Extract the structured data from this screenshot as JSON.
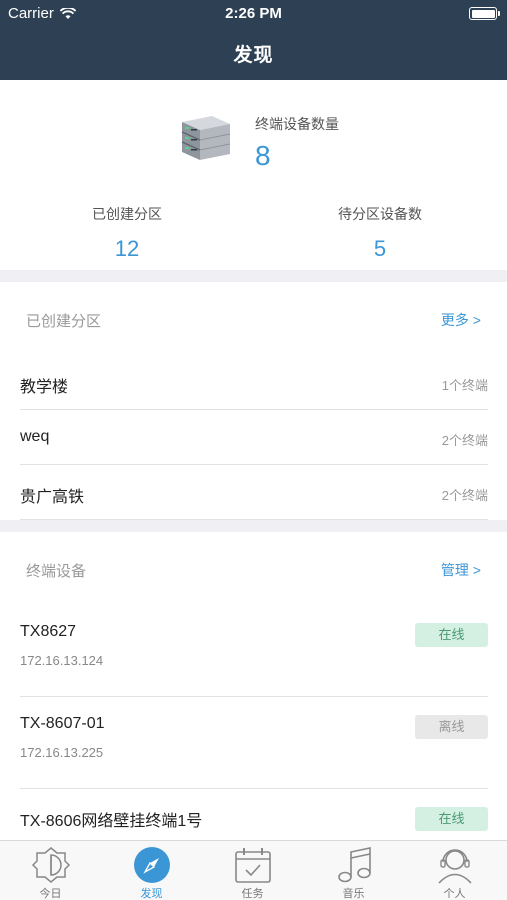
{
  "status_bar": {
    "carrier": "Carrier",
    "time": "2:26 PM"
  },
  "nav": {
    "title": "发现"
  },
  "stats": {
    "total_label": "终端设备数量",
    "total_value": "8",
    "zones_label": "已创建分区",
    "zones_value": "12",
    "pending_label": "待分区设备数",
    "pending_value": "5"
  },
  "zones_section": {
    "title": "已创建分区",
    "more": "更多 >",
    "items": [
      {
        "name": "教学楼",
        "count": "1个终端"
      },
      {
        "name": "weq",
        "count": "2个终端"
      },
      {
        "name": "贵广高铁",
        "count": "2个终端"
      }
    ]
  },
  "devices_section": {
    "title": "终端设备",
    "manage": "管理 >",
    "items": [
      {
        "name": "TX8627",
        "ip": "172.16.13.124",
        "status": "在线"
      },
      {
        "name": "TX-8607-01",
        "ip": "172.16.13.225",
        "status": "离线"
      },
      {
        "name": "TX-8606网络壁挂终端1号",
        "ip": "",
        "status": "在线"
      }
    ]
  },
  "tabbar": {
    "items": [
      {
        "label": "今日",
        "icon": "today-icon"
      },
      {
        "label": "发现",
        "icon": "compass-icon"
      },
      {
        "label": "任务",
        "icon": "calendar-icon"
      },
      {
        "label": "音乐",
        "icon": "music-icon"
      },
      {
        "label": "个人",
        "icon": "person-icon"
      }
    ],
    "active_index": 1
  },
  "colors": {
    "nav_bg": "#2e4154",
    "accent": "#3b96d6",
    "online_bg": "#d4f0e2",
    "online_text": "#4a9a73",
    "offline_bg": "#e8e8e8",
    "offline_text": "#999999"
  }
}
